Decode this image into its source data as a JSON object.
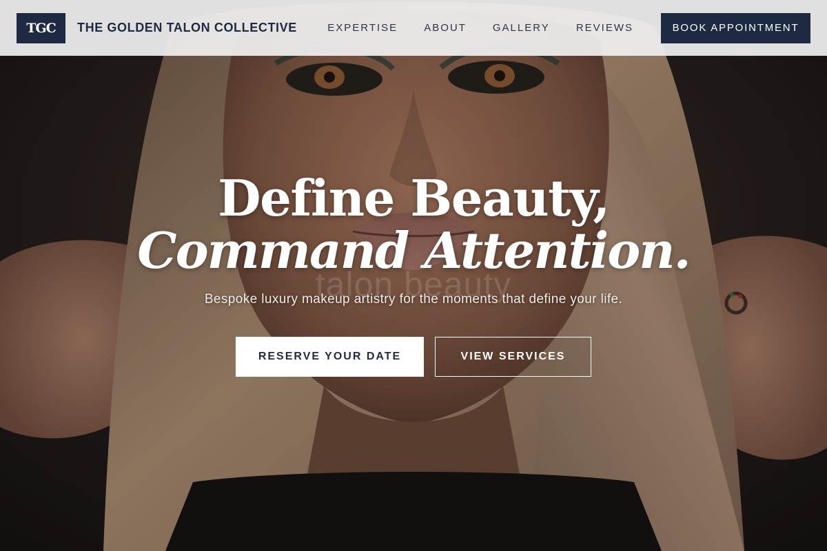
{
  "brand": {
    "logo_text": "TGC",
    "name": "THE GOLDEN TALON COLLECTIVE",
    "navy": "#1d2a42"
  },
  "nav": {
    "links": [
      "EXPERTISE",
      "ABOUT",
      "GALLERY",
      "REVIEWS"
    ],
    "book_label": "BOOK APPOINTMENT"
  },
  "hero": {
    "headline_line1": "Define Beauty,",
    "headline_line2": "Command Attention.",
    "watermark": "talon beauty",
    "subtitle": "Bespoke luxury makeup artistry for the moments that define your life.",
    "primary_cta": "RESERVE YOUR DATE",
    "secondary_cta": "VIEW SERVICES",
    "image_alt_icon": "portrait-photo"
  }
}
